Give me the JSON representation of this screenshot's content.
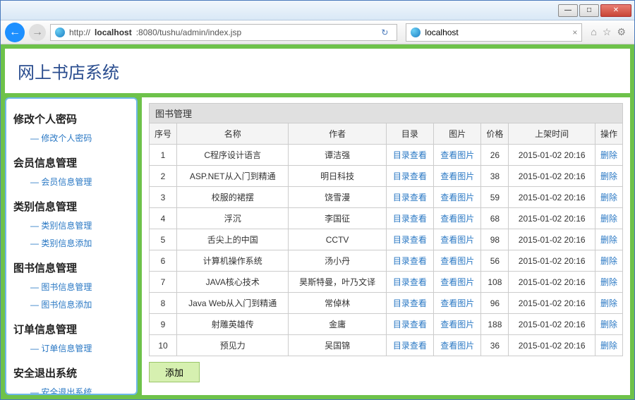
{
  "browser": {
    "url_prefix": "http://",
    "url_host": "localhost",
    "url_port_path": ":8080/tushu/admin/index.jsp",
    "tab_title": "localhost"
  },
  "header": {
    "title": "网上书店系统"
  },
  "sidebar": [
    {
      "title": "修改个人密码",
      "subs": [
        "修改个人密码"
      ]
    },
    {
      "title": "会员信息管理",
      "subs": [
        "会员信息管理"
      ]
    },
    {
      "title": "类别信息管理",
      "subs": [
        "类别信息管理",
        "类别信息添加"
      ]
    },
    {
      "title": "图书信息管理",
      "subs": [
        "图书信息管理",
        "图书信息添加"
      ]
    },
    {
      "title": "订单信息管理",
      "subs": [
        "订单信息管理"
      ]
    },
    {
      "title": "安全退出系统",
      "subs": [
        "安全退出系统"
      ]
    }
  ],
  "panel": {
    "title": "图书管理",
    "columns": [
      "序号",
      "名称",
      "作者",
      "目录",
      "图片",
      "价格",
      "上架时间",
      "操作"
    ],
    "catalog_link": "目录查看",
    "image_link": "查看图片",
    "delete_label": "删除",
    "add_label": "添加",
    "rows": [
      {
        "no": "1",
        "name": "C程序设计语言",
        "author": "谭洁强",
        "price": "26",
        "time": "2015-01-02 20:16"
      },
      {
        "no": "2",
        "name": "ASP.NET从入门到精通",
        "author": "明日科技",
        "price": "38",
        "time": "2015-01-02 20:16"
      },
      {
        "no": "3",
        "name": "校服的裙摆",
        "author": "饶雪漫",
        "price": "59",
        "time": "2015-01-02 20:16"
      },
      {
        "no": "4",
        "name": "浮沉",
        "author": "李国征",
        "price": "68",
        "time": "2015-01-02 20:16"
      },
      {
        "no": "5",
        "name": "舌尖上的中国",
        "author": "CCTV",
        "price": "98",
        "time": "2015-01-02 20:16"
      },
      {
        "no": "6",
        "name": "计算机操作系统",
        "author": "汤小丹",
        "price": "56",
        "time": "2015-01-02 20:16"
      },
      {
        "no": "7",
        "name": "JAVA核心技术",
        "author": "昊斯特曼，叶乃文译",
        "price": "108",
        "time": "2015-01-02 20:16"
      },
      {
        "no": "8",
        "name": "Java Web从入门到精通",
        "author": "常倬林",
        "price": "96",
        "time": "2015-01-02 20:16"
      },
      {
        "no": "9",
        "name": "射雕英雄传",
        "author": "金庸",
        "price": "188",
        "time": "2015-01-02 20:16"
      },
      {
        "no": "10",
        "name": "预见力",
        "author": "吴国锦",
        "price": "36",
        "time": "2015-01-02 20:16"
      }
    ]
  }
}
